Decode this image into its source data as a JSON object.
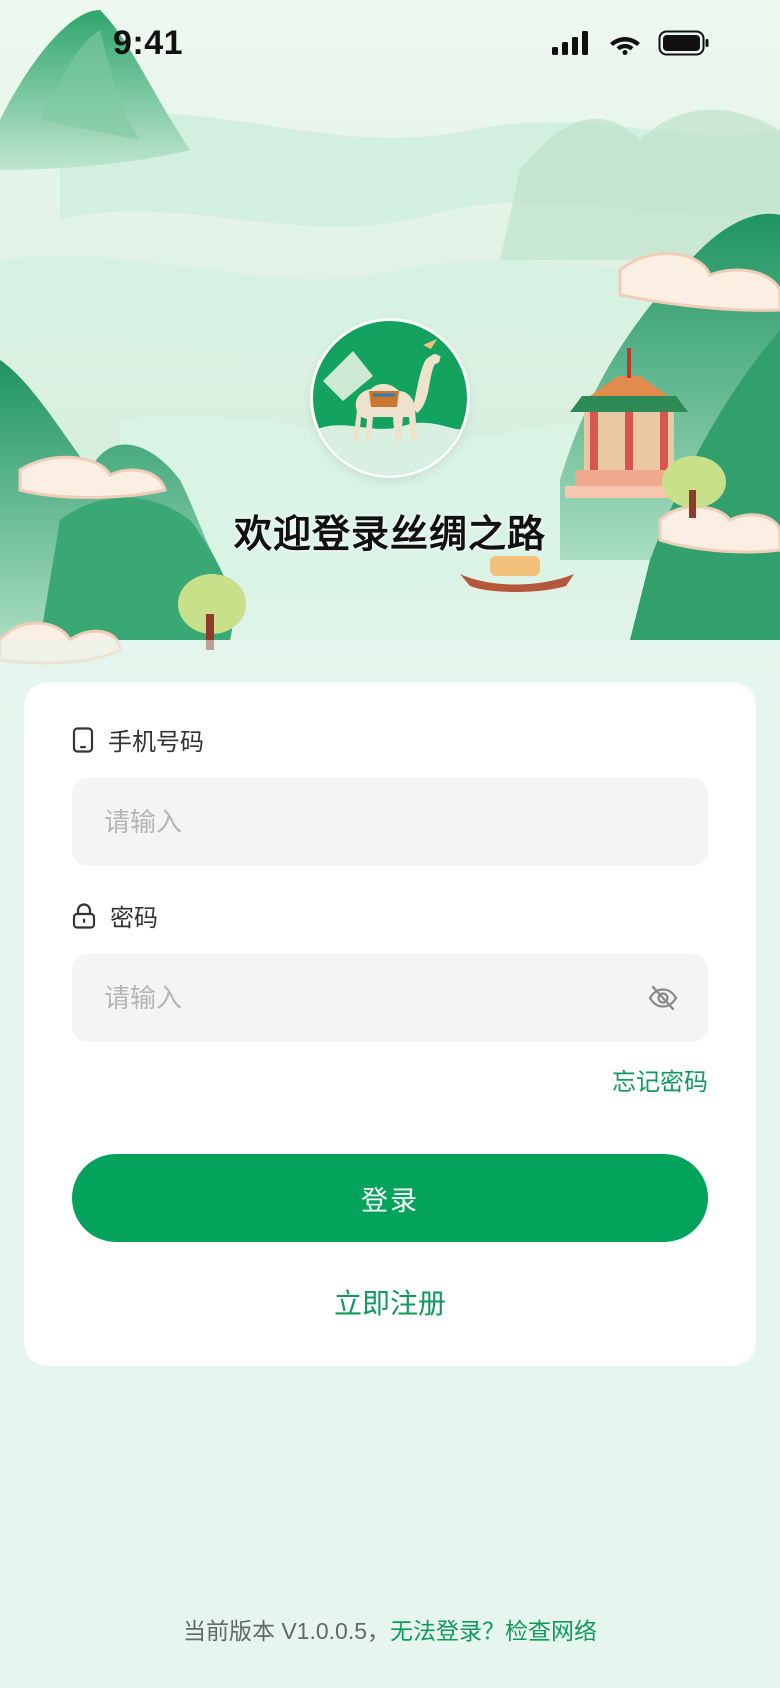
{
  "status_bar": {
    "time": "9:41",
    "icons": [
      "cellular-signal-icon",
      "wifi-icon",
      "battery-icon"
    ]
  },
  "welcome": {
    "title": "欢迎登录丝绸之路",
    "logo_icon": "camel-logo-icon"
  },
  "form": {
    "phone": {
      "label": "手机号码",
      "icon": "phone-icon",
      "placeholder": "请输入",
      "value": ""
    },
    "password": {
      "label": "密码",
      "icon": "lock-icon",
      "placeholder": "请输入",
      "value": "",
      "toggle_icon": "eye-off-icon"
    },
    "forgot_label": "忘记密码",
    "login_label": "登录",
    "register_label": "立即注册"
  },
  "footer": {
    "version_text": "当前版本 V1.0.0.5",
    "separator": "，",
    "link_text": "无法登录？检查网络"
  },
  "colors": {
    "accent": "#04a35c",
    "link": "#0f9a5a",
    "background": "#e6f6ee",
    "input_bg": "#f4f4f4"
  }
}
